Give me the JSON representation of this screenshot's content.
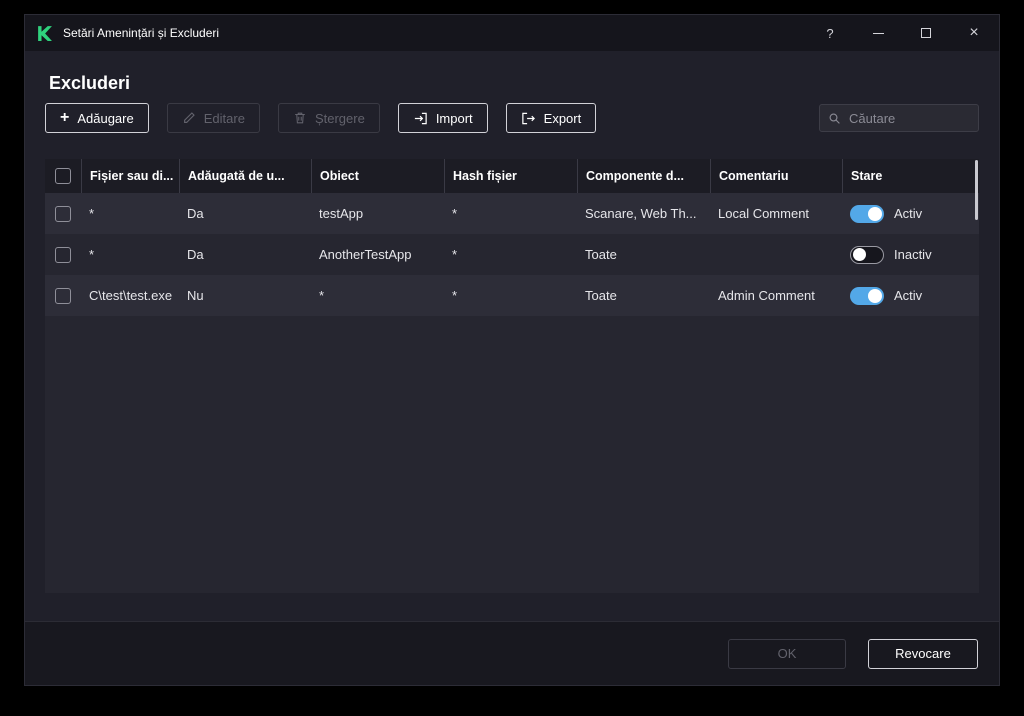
{
  "window": {
    "title": "Setări Amenințări și Excluderi",
    "controls": {
      "help": "?",
      "close": "×"
    }
  },
  "page": {
    "title": "Excluderi"
  },
  "toolbar": {
    "add": "Adăugare",
    "edit": "Editare",
    "delete": "Ștergere",
    "import": "Import",
    "export": "Export",
    "search_placeholder": "Căutare"
  },
  "table": {
    "columns": {
      "file": "Fișier sau di...",
      "added": "Adăugată de u...",
      "object": "Obiect",
      "hash": "Hash fișier",
      "components": "Componente d...",
      "comment": "Comentariu",
      "state": "Stare"
    },
    "rows": [
      {
        "file": "*",
        "added": "Da",
        "object": "testApp",
        "hash": "*",
        "components": "Scanare, Web Th...",
        "comment": "Local Comment",
        "state": "Activ",
        "active": true
      },
      {
        "file": "*",
        "added": "Da",
        "object": "AnotherTestApp",
        "hash": "*",
        "components": "Toate",
        "comment": "",
        "state": "Inactiv",
        "active": false
      },
      {
        "file": "C\\test\\test.exe",
        "added": "Nu",
        "object": "*",
        "hash": "*",
        "components": "Toate",
        "comment": "Admin Comment",
        "state": "Activ",
        "active": true
      }
    ]
  },
  "footer": {
    "ok": "OK",
    "cancel": "Revocare"
  },
  "colors": {
    "accent": "#53a8e8",
    "brand": "#2fd27d"
  }
}
